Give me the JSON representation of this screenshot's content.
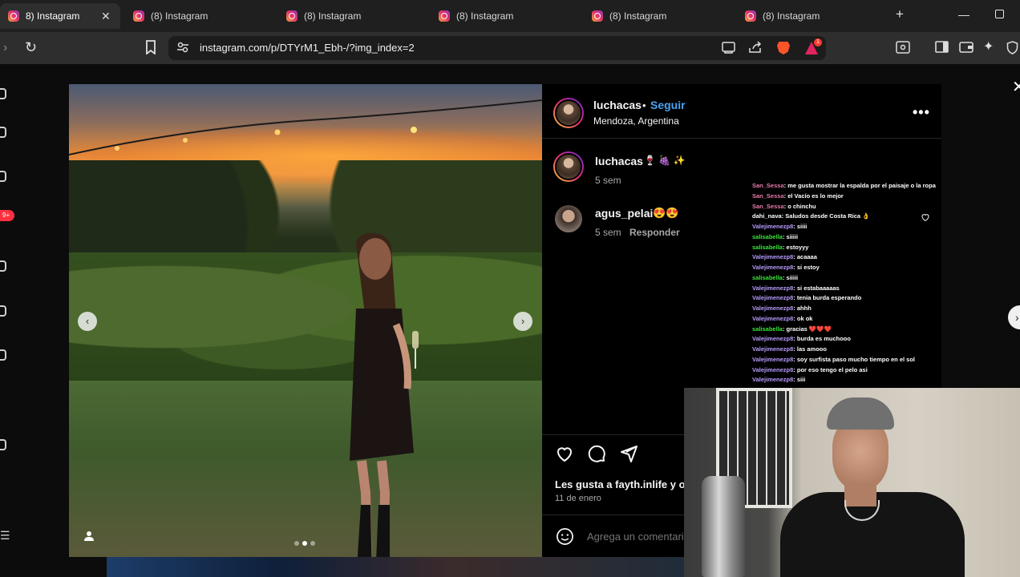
{
  "browser": {
    "tabs": [
      {
        "title": "(8) Instagram",
        "active": true
      },
      {
        "title": "(8) Instagram",
        "active": false
      },
      {
        "title": "(8) Instagram",
        "active": false
      },
      {
        "title": "(8) Instagram",
        "active": false
      },
      {
        "title": "(8) Instagram",
        "active": false
      },
      {
        "title": "(8) Instagram",
        "active": false
      }
    ],
    "active_tab_title": "8) Instagram",
    "url": "instagram.com/p/DTYrM1_Ebh-/?img_index=2",
    "rewards_badge": "1"
  },
  "page": {
    "notification_count": "9+"
  },
  "post": {
    "author": "luchacas",
    "follow_label": "Seguir",
    "separator": "•",
    "location": "Mendoza, Argentina",
    "caption_author": "luchacas",
    "caption_emoji": "🍷 🍇 ✨",
    "caption_time": "5 sem",
    "carousel": {
      "count": 3,
      "current": 2
    },
    "comments": [
      {
        "user": "agus_pelai",
        "text": "😍😍",
        "time": "5 sem",
        "reply_label": "Responder"
      }
    ],
    "likes_text": "Les gusta a fayth.inlife y o",
    "date": "11 de enero",
    "comment_placeholder": "Agrega un comentario..."
  },
  "stream_chat": [
    {
      "user": "San_Sessa",
      "color": "#e87ba8",
      "msg": "me gusta mostrar la espalda por el paisaje o la ropa"
    },
    {
      "user": "San_Sessa",
      "color": "#e87ba8",
      "msg": "el Vacío es lo mejor"
    },
    {
      "user": "San_Sessa",
      "color": "#e87ba8",
      "msg": "o chinchu"
    },
    {
      "user": "dahi_nava",
      "color": "#ffffff",
      "msg": "Saludos desde Costa Rica 👌"
    },
    {
      "user": "Valejimenezp8",
      "color": "#b89cff",
      "msg": "siiii"
    },
    {
      "user": "salisabella",
      "color": "#39e639",
      "msg": "siiiii"
    },
    {
      "user": "salisabella",
      "color": "#39e639",
      "msg": "estoyyy"
    },
    {
      "user": "Valejimenezp8",
      "color": "#b89cff",
      "msg": "acaaaa"
    },
    {
      "user": "Valejimenezp8",
      "color": "#b89cff",
      "msg": "si estoy"
    },
    {
      "user": "salisabella",
      "color": "#39e639",
      "msg": "siiiii"
    },
    {
      "user": "Valejimenezp8",
      "color": "#b89cff",
      "msg": "si estabaaaaas"
    },
    {
      "user": "Valejimenezp8",
      "color": "#b89cff",
      "msg": "tenia burda esperando"
    },
    {
      "user": "Valejimenezp8",
      "color": "#b89cff",
      "msg": "ahhh"
    },
    {
      "user": "Valejimenezp8",
      "color": "#b89cff",
      "msg": "ok ok"
    },
    {
      "user": "salisabella",
      "color": "#39e639",
      "msg": "gracias ❤️❤️❤️"
    },
    {
      "user": "Valejimenezp8",
      "color": "#b89cff",
      "msg": "burda es muchooo"
    },
    {
      "user": "Valejimenezp8",
      "color": "#b89cff",
      "msg": "las amooo"
    },
    {
      "user": "Valejimenezp8",
      "color": "#b89cff",
      "msg": "soy surfista paso mucho tiempo en el sol"
    },
    {
      "user": "Valejimenezp8",
      "color": "#b89cff",
      "msg": "por eso tengo el pelo asi"
    },
    {
      "user": "Valejimenezp8",
      "color": "#b89cff",
      "msg": "siii"
    }
  ],
  "colors": {
    "accent_follow": "#4aa3f0",
    "chat_pink": "#e87ba8",
    "chat_purple": "#b89cff",
    "chat_green": "#39e639"
  },
  "icons": [
    "instagram-favicon",
    "close-icon",
    "plus-icon",
    "minimize-icon",
    "maximize-icon",
    "forward-icon",
    "reload-icon",
    "bookmark-icon",
    "site-settings-icon",
    "cast-icon",
    "share-icon",
    "brave-shields-icon",
    "brave-rewards-icon",
    "reader-icon",
    "sidebar-icon",
    "wallet-icon",
    "leo-ai-icon",
    "vpn-icon",
    "heart-icon",
    "comment-icon",
    "share-post-icon",
    "emoji-icon",
    "more-options-icon",
    "tag-user-icon",
    "chevron-left-icon",
    "chevron-right-icon"
  ]
}
